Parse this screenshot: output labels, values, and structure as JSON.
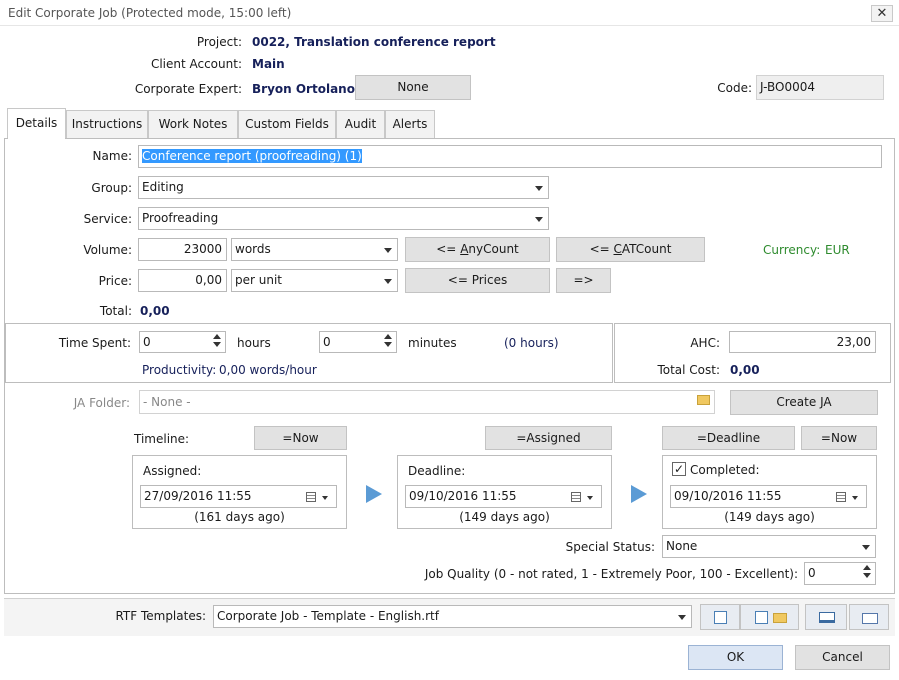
{
  "window": {
    "title": "Edit Corporate Job (Protected mode, 15:00 left)"
  },
  "header": {
    "project_label": "Project:",
    "project_value": "0022, Translation conference report",
    "client_label": "Client Account:",
    "client_value": "Main",
    "expert_label": "Corporate Expert:",
    "expert_value": "Bryon Ortolano",
    "expert_button": "None",
    "code_label": "Code:",
    "code_value": "J-BO0004"
  },
  "tabs": [
    "Details",
    "Instructions",
    "Work Notes",
    "Custom Fields",
    "Audit",
    "Alerts"
  ],
  "details": {
    "name_label": "Name:",
    "name_value": "Conference report (proofreading) (1)",
    "group_label": "Group:",
    "group_value": "Editing",
    "service_label": "Service:",
    "service_value": "Proofreading",
    "volume_label": "Volume:",
    "volume_value": "23000",
    "volume_unit": "words",
    "anycount_prefix": "<= ",
    "anycount_ul": "A",
    "anycount_rest": "nyCount",
    "catcount_prefix": "<= ",
    "catcount_ul": "C",
    "catcount_rest": "ATCount",
    "currency_label": "Currency:",
    "currency_value": "EUR",
    "price_label": "Price:",
    "price_value": "0,00",
    "price_unit": "per unit",
    "prices_button": "<= Prices",
    "forward_button": "=>",
    "total_label": "Total:",
    "total_value": "0,00"
  },
  "time": {
    "spent_label": "Time Spent:",
    "hours_value": "0",
    "hours_label": "hours",
    "minutes_value": "0",
    "minutes_label": "minutes",
    "hours_total": "(0 hours)",
    "productivity_label": "Productivity:",
    "productivity_value": "0,00 words/hour",
    "ahc_label": "AHC:",
    "ahc_value": "23,00",
    "total_cost_label": "Total Cost:",
    "total_cost_value": "0,00"
  },
  "ja": {
    "folder_label": "JA Folder:",
    "folder_value": "- None -",
    "create_button": "Create JA"
  },
  "timeline": {
    "label": "Timeline:",
    "now_button": "=Now",
    "assigned_button": "=Assigned",
    "deadline_button": "=Deadline",
    "now_button_2": "=Now",
    "assigned_label": "Assigned:",
    "assigned_value": "27/09/2016 11:55",
    "assigned_ago": "(161 days ago)",
    "deadline_label": "Deadline:",
    "deadline_value": "09/10/2016 11:55",
    "deadline_ago": "(149 days ago)",
    "completed_label": "Completed:",
    "completed_checked": true,
    "completed_check_glyph": "✓",
    "completed_value": "09/10/2016 11:55",
    "completed_ago": "(149 days ago)"
  },
  "status": {
    "special_label": "Special Status:",
    "special_value": "None",
    "quality_label": "Job Quality (0 - not rated, 1 - Extremely Poor, 100 - Excellent):",
    "quality_value": "0"
  },
  "footer": {
    "rtf_label": "RTF Templates:",
    "rtf_value": "Corporate Job - Template - English.rtf",
    "ok_button": "OK",
    "cancel_button": "Cancel"
  },
  "colors": {
    "accent_navy": "#16205a",
    "currency_green": "#2e8b2e",
    "selection_blue": "#3399ff",
    "arrow_blue": "#5b9bd5"
  }
}
